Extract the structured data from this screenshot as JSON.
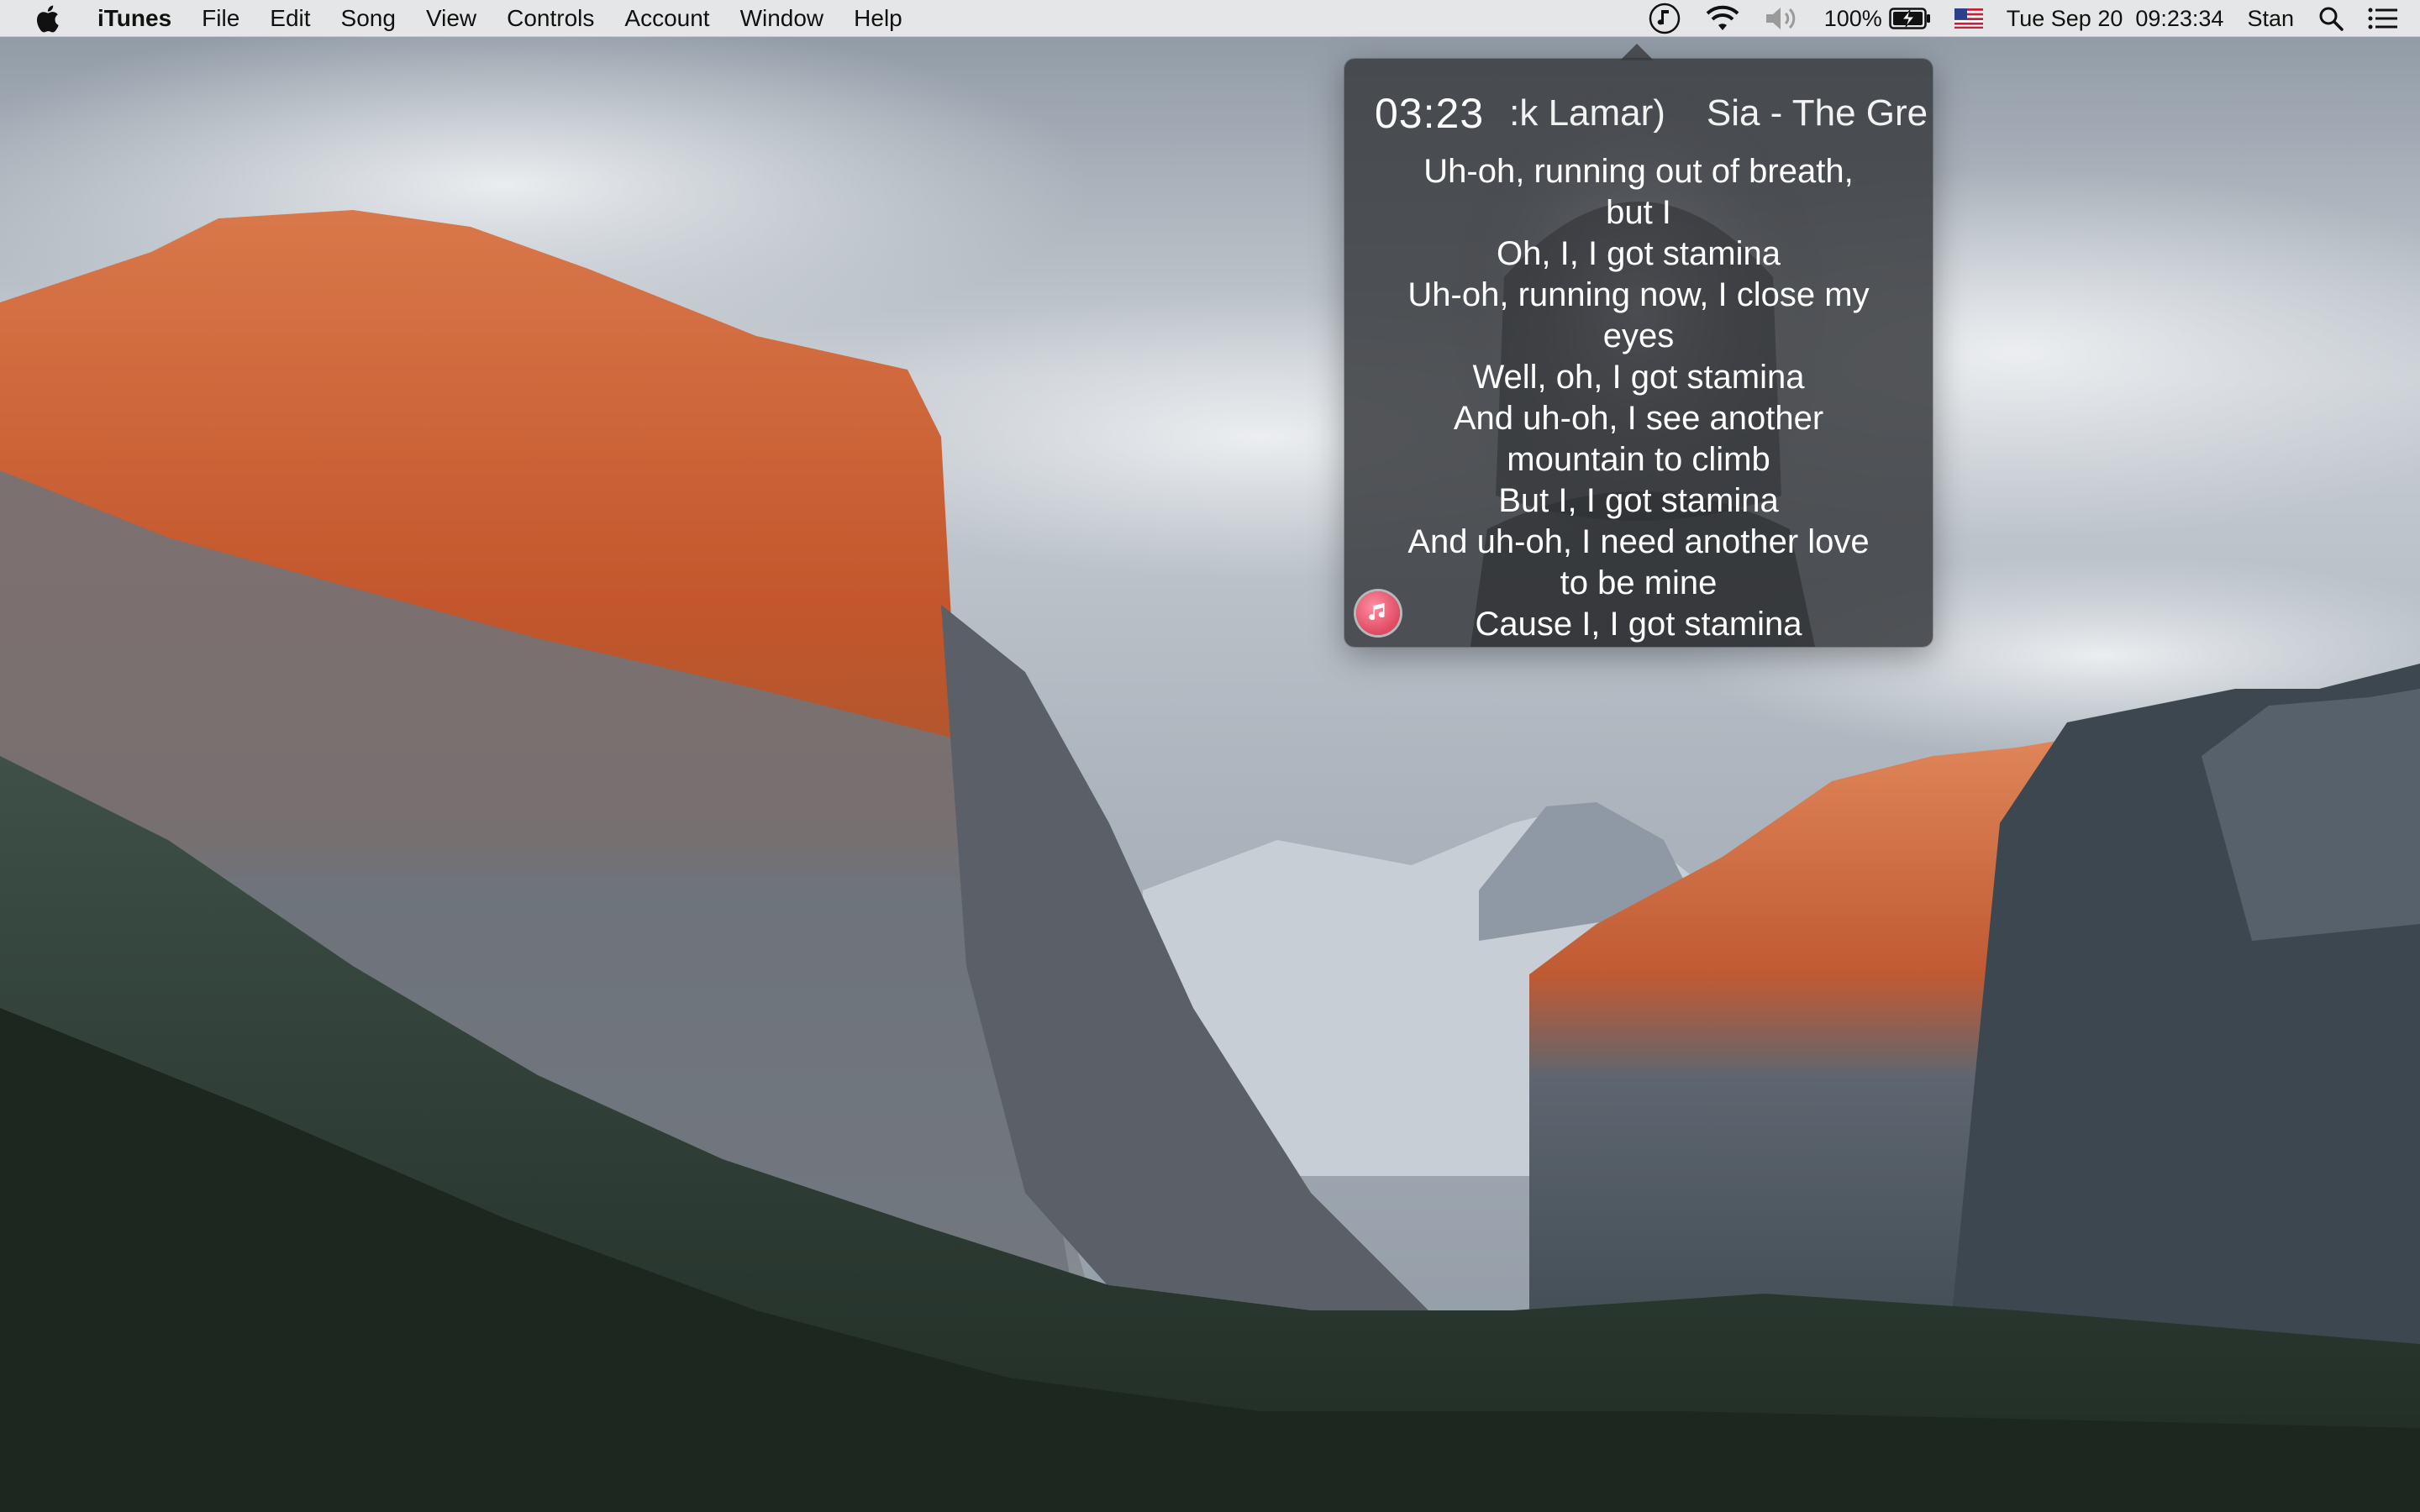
{
  "menubar": {
    "app_name": "iTunes",
    "menus": [
      "File",
      "Edit",
      "Song",
      "View",
      "Controls",
      "Account",
      "Window",
      "Help"
    ],
    "battery_percent": "100%",
    "datetime": "Tue Sep 20  09:23:34",
    "user": "Stan",
    "icons": [
      "apple-icon",
      "music-note-icon",
      "wifi-icon",
      "volume-icon",
      "battery-charging-icon",
      "us-flag-icon",
      "search-icon",
      "notification-center-icon"
    ]
  },
  "popover": {
    "time": "03:23",
    "title_scroll": ":k Lamar)    Sia - The Grea",
    "lyrics": [
      "Uh-oh, running out of breath,",
      "but I",
      "Oh, I, I got stamina",
      "Uh-oh, running now, I close my",
      "eyes",
      "Well, oh, I got stamina",
      "And uh-oh, I see another",
      "mountain to climb",
      "But I, I got stamina",
      "And uh-oh, I need another love",
      "to be mine",
      "Cause I, I got stamina"
    ],
    "badge_icon": "itunes-music-icon"
  },
  "colors": {
    "popover_bg": "#3a3c40",
    "badge": "#e04a62",
    "menubar_bg": "#ececec"
  }
}
